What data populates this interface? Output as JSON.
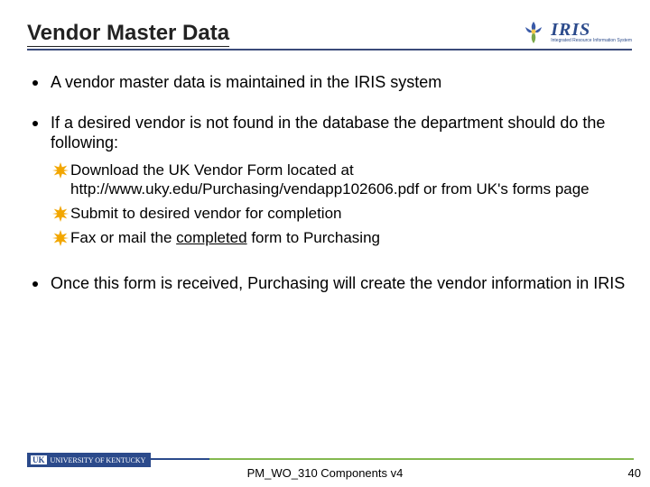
{
  "title": "Vendor Master Data",
  "logo": {
    "main": "IRIS",
    "sub": "Integrated Resource Information System"
  },
  "bullets": {
    "b1": "A vendor master data is maintained in the IRIS system",
    "b2": "If a desired vendor is not found in the database the department should do the following:",
    "s1a": "Download the UK Vendor Form located at http://www.uky.edu/Purchasing/vendapp102606.pdf or from UK's forms page",
    "s2": "Submit to desired vendor for completion",
    "s3a": "Fax or mail the ",
    "s3b": "completed",
    "s3c": " form to Purchasing",
    "b3": "Once this form is received, Purchasing will create the vendor information in IRIS"
  },
  "footer": {
    "uk_mark": "UK",
    "uk_text": "UNIVERSITY OF KENTUCKY",
    "center": "PM_WO_310 Components v4",
    "page": "40"
  }
}
